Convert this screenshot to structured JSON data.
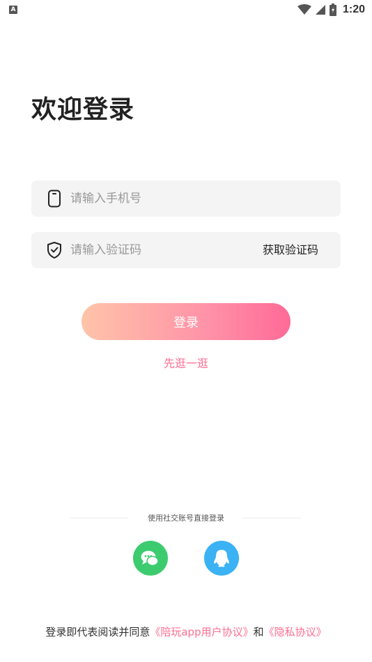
{
  "status_bar": {
    "time": "1:20",
    "notification_badge": "A"
  },
  "title": "欢迎登录",
  "phone_field": {
    "placeholder": "请输入手机号",
    "icon": "phone-icon"
  },
  "code_field": {
    "placeholder": "请输入验证码",
    "icon": "shield-check-icon",
    "get_code_label": "获取验证码"
  },
  "login_button": {
    "label": "登录"
  },
  "browse_link": {
    "label": "先逛一逛"
  },
  "social": {
    "label": "使用社交账号直接登录",
    "providers": [
      {
        "name": "wechat",
        "icon": "wechat-icon",
        "color": "#3ccb6e"
      },
      {
        "name": "qq",
        "icon": "qq-icon",
        "color": "#3ab2f4"
      }
    ]
  },
  "agreement": {
    "prefix": "登录即代表阅读并同意",
    "user_agreement": "《陪玩app用户协议》",
    "conjunction": "和",
    "privacy_policy": "《隐私协议》"
  },
  "colors": {
    "accent": "#ff6e92",
    "gradient_start": "#ffc4a9",
    "gradient_end": "#ff6a97"
  }
}
